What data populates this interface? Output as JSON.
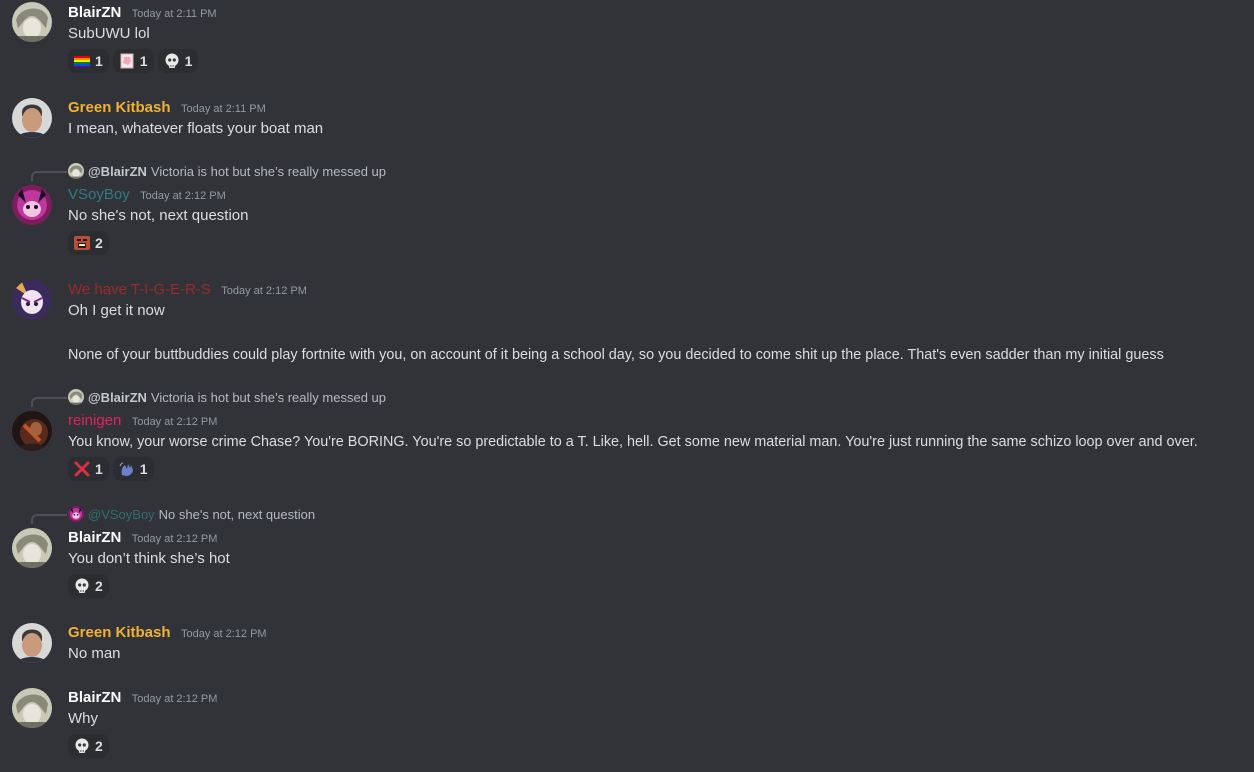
{
  "colors": {
    "background": "#313338",
    "blair": "#ffffff",
    "green_kitbash": "#f0b232",
    "vsoyboy": "#2f7d80",
    "tigers": "#9b2b2b",
    "reinigen": "#e0245e"
  },
  "messages": [
    {
      "author": "BlairZN",
      "time": "Today at 2:11 PM",
      "lines": [
        "SubUWU lol"
      ],
      "reactions": [
        {
          "emoji": "rainbow-flag-icon",
          "count": "1"
        },
        {
          "emoji": "anime-sticker-icon",
          "count": "1"
        },
        {
          "emoji": "skull-face-icon",
          "count": "1"
        }
      ]
    },
    {
      "author": "Green Kitbash",
      "time": "Today at 2:11 PM",
      "lines": [
        "I mean, whatever floats your boat man"
      ]
    },
    {
      "reply": {
        "name": "@BlairZN",
        "text": "Victoria is hot but she’s really messed up"
      },
      "author": "VSoyBoy",
      "time": "Today at 2:12 PM",
      "lines": [
        "No she's not, next question"
      ],
      "reactions": [
        {
          "emoji": "shouting-face-icon",
          "count": "2"
        }
      ]
    },
    {
      "author": "We have T-I-G-E-R-S",
      "time": "Today at 2:12 PM",
      "lines": [
        "Oh I get it now",
        "None of your buttbuddies could play fortnite with you, on account of it being a school day, so you decided to come shit up the place. That's even sadder than my initial guess"
      ]
    },
    {
      "reply": {
        "name": "@BlairZN",
        "text": "Victoria is hot but she’s really messed up"
      },
      "author": "reinigen",
      "time": "Today at 2:12 PM",
      "lines": [
        "You know, your worse crime Chase? You're BORING. You're so predictable to a T. Like, hell. Get some new material man. You're just running the same schizo loop over and over."
      ],
      "reactions": [
        {
          "emoji": "red-x-icon",
          "count": "1"
        },
        {
          "emoji": "waving-hand-icon",
          "count": "1"
        }
      ]
    },
    {
      "reply": {
        "name": "@VSoyBoy",
        "text": "No she's not, next question"
      },
      "author": "BlairZN",
      "time": "Today at 2:12 PM",
      "lines": [
        "You don’t think she’s hot"
      ],
      "reactions": [
        {
          "emoji": "skull-face-icon",
          "count": "2"
        }
      ]
    },
    {
      "author": "Green Kitbash",
      "time": "Today at 2:12 PM",
      "lines": [
        "No man"
      ]
    },
    {
      "author": "BlairZN",
      "time": "Today at 2:12 PM",
      "lines": [
        "Why"
      ],
      "reactions": [
        {
          "emoji": "skull-face-icon",
          "count": "2"
        }
      ]
    }
  ]
}
